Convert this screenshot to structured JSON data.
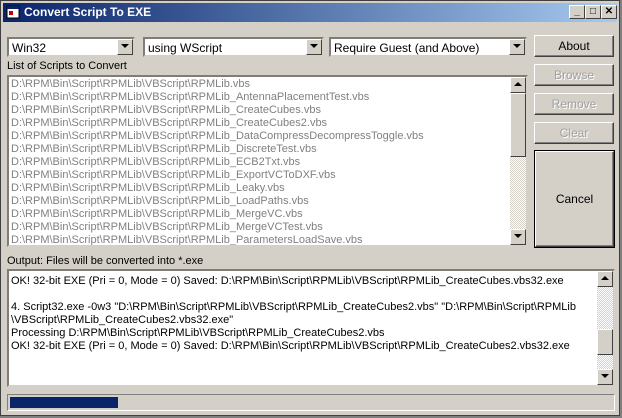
{
  "window": {
    "title": "Convert Script To EXE",
    "buttons": {
      "minimize": "_",
      "maximize": "□",
      "close": "✕"
    }
  },
  "toolbar": {
    "platform": "Win32",
    "host": "using WScript",
    "privilege": "Require Guest (and Above)"
  },
  "scripts": {
    "label": "List of Scripts to Convert",
    "items": [
      "D:\\RPM\\Bin\\Script\\RPMLib\\VBScript\\RPMLib.vbs",
      "D:\\RPM\\Bin\\Script\\RPMLib\\VBScript\\RPMLib_AntennaPlacementTest.vbs",
      "D:\\RPM\\Bin\\Script\\RPMLib\\VBScript\\RPMLib_CreateCubes.vbs",
      "D:\\RPM\\Bin\\Script\\RPMLib\\VBScript\\RPMLib_CreateCubes2.vbs",
      "D:\\RPM\\Bin\\Script\\RPMLib\\VBScript\\RPMLib_DataCompressDecompressToggle.vbs",
      "D:\\RPM\\Bin\\Script\\RPMLib\\VBScript\\RPMLib_DiscreteTest.vbs",
      "D:\\RPM\\Bin\\Script\\RPMLib\\VBScript\\RPMLib_ECB2Txt.vbs",
      "D:\\RPM\\Bin\\Script\\RPMLib\\VBScript\\RPMLib_ExportVCToDXF.vbs",
      "D:\\RPM\\Bin\\Script\\RPMLib\\VBScript\\RPMLib_Leaky.vbs",
      "D:\\RPM\\Bin\\Script\\RPMLib\\VBScript\\RPMLib_LoadPaths.vbs",
      "D:\\RPM\\Bin\\Script\\RPMLib\\VBScript\\RPMLib_MergeVC.vbs",
      "D:\\RPM\\Bin\\Script\\RPMLib\\VBScript\\RPMLib_MergeVCTest.vbs",
      "D:\\RPM\\Bin\\Script\\RPMLib\\VBScript\\RPMLib_ParametersLoadSave.vbs"
    ]
  },
  "actions": {
    "about": "About",
    "browse": "Browse",
    "remove": "Remove",
    "clear": "Clear",
    "cancel": "Cancel"
  },
  "output": {
    "label": "Output: Files will be converted into *.exe",
    "lines": [
      "OK! 32-bit EXE (Pri = 0, Mode = 0) Saved: D:\\RPM\\Bin\\Script\\RPMLib\\VBScript\\RPMLib_CreateCubes.vbs32.exe",
      "",
      "4. Script32.exe -0w3 \"D:\\RPM\\Bin\\Script\\RPMLib\\VBScript\\RPMLib_CreateCubes2.vbs\"  \"D:\\RPM\\Bin\\Script\\RPMLib",
      "\\VBScript\\RPMLib_CreateCubes2.vbs32.exe\"",
      "Processing D:\\RPM\\Bin\\Script\\RPMLib\\VBScript\\RPMLib_CreateCubes2.vbs",
      "OK! 32-bit EXE (Pri = 0, Mode = 0) Saved: D:\\RPM\\Bin\\Script\\RPMLib\\VBScript\\RPMLib_CreateCubes2.vbs32.exe"
    ]
  },
  "progress": {
    "fraction": 0.18
  }
}
